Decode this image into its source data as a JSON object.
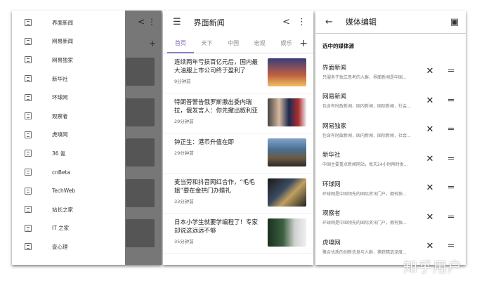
{
  "drawer": {
    "items": [
      "界面新闻",
      "网易新闻",
      "网易独家",
      "新华社",
      "环球网",
      "观察者",
      "虎嗅网",
      "36 氪",
      "cnBeta",
      "TechWeb",
      "站长之家",
      "IT 之家",
      "壹心理"
    ]
  },
  "news_screen": {
    "title": "界面新闻",
    "tabs": [
      "首页",
      "天下",
      "中国",
      "宏观",
      "娱乐"
    ],
    "active_tab": "首页",
    "items": [
      {
        "title": "连续两年亏损百亿元后，国内最大油服上市公司终于盈利了",
        "time": "9分钟前"
      },
      {
        "title": "特朗普警告俄罗斯撤出委内瑞拉，俄发言人：你先撤出叙利亚",
        "time": "29分钟前"
      },
      {
        "title": "钟正生：港币升值在即",
        "time": "29分钟前"
      },
      {
        "title": "麦当劳和抖音网红合作，“毛毛姐”要在金拱门办婚礼",
        "time": "33分钟前"
      },
      {
        "title": "日本小学生就要学编程了！专家却说这远远不够",
        "time": "35分钟前"
      }
    ]
  },
  "edit_screen": {
    "title": "媒体编辑",
    "section": "选中的媒体源",
    "items": [
      {
        "name": "界面新闻",
        "desc": "只服务于独立思考的人群，界面新闻是中国..."
      },
      {
        "name": "网易新闻",
        "desc": "包含有时政新闻，国内新闻，国际新闻，社会..."
      },
      {
        "name": "网易独家",
        "desc": "包含有时政新闻，国内新闻，国际新闻，社会..."
      },
      {
        "name": "新华社",
        "desc": "中国主要重点新闻网站，每天24小时再时发..."
      },
      {
        "name": "环球网",
        "desc": "环球网是中国领先的国际资讯门户，拥有独..."
      },
      {
        "name": "观察者",
        "desc": "环球网是中国领先的国际资讯门户，拥有独..."
      },
      {
        "name": "虎嗅网",
        "desc": "聚合优质的创新信息与人群，捕获精选深度..."
      }
    ]
  },
  "watermark": "知乎用户",
  "colors": {
    "accent": "#8e7cc3"
  }
}
